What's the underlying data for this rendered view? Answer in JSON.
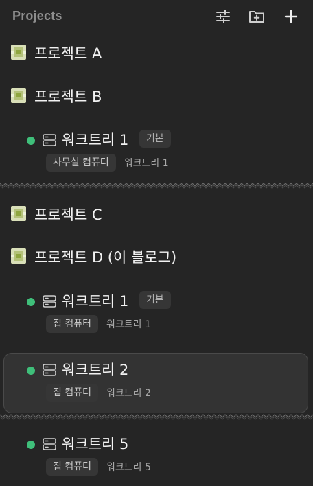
{
  "header": {
    "title": "Projects",
    "icons": [
      "sliders-icon",
      "folder-plus-icon",
      "plus-icon"
    ]
  },
  "colors": {
    "background": "#252525",
    "status_green": "#3fbf7a",
    "chip_bg": "#363636",
    "selected_bg": "#333333"
  },
  "projects": [
    {
      "name": "프로젝트 A"
    },
    {
      "name": "프로젝트 B"
    },
    {
      "name": "프로젝트 C"
    },
    {
      "name": "프로젝트 D (이 블로그)"
    }
  ],
  "worktrees": [
    {
      "name": "워크트리 1",
      "badge": "기본",
      "machine": "사무실 컴퓨터",
      "branch": "워크트리 1",
      "status": "active"
    },
    {
      "name": "워크트리 1",
      "badge": "기본",
      "machine": "집 컴퓨터",
      "branch": "워크트리 1",
      "status": "active"
    },
    {
      "name": "워크트리 2",
      "badge": "",
      "machine": "집 컴퓨터",
      "branch": "워크트리 2",
      "status": "active",
      "selected": true
    },
    {
      "name": "워크트리 5",
      "badge": "",
      "machine": "집 컴퓨터",
      "branch": "워크트리 5",
      "status": "active"
    }
  ]
}
